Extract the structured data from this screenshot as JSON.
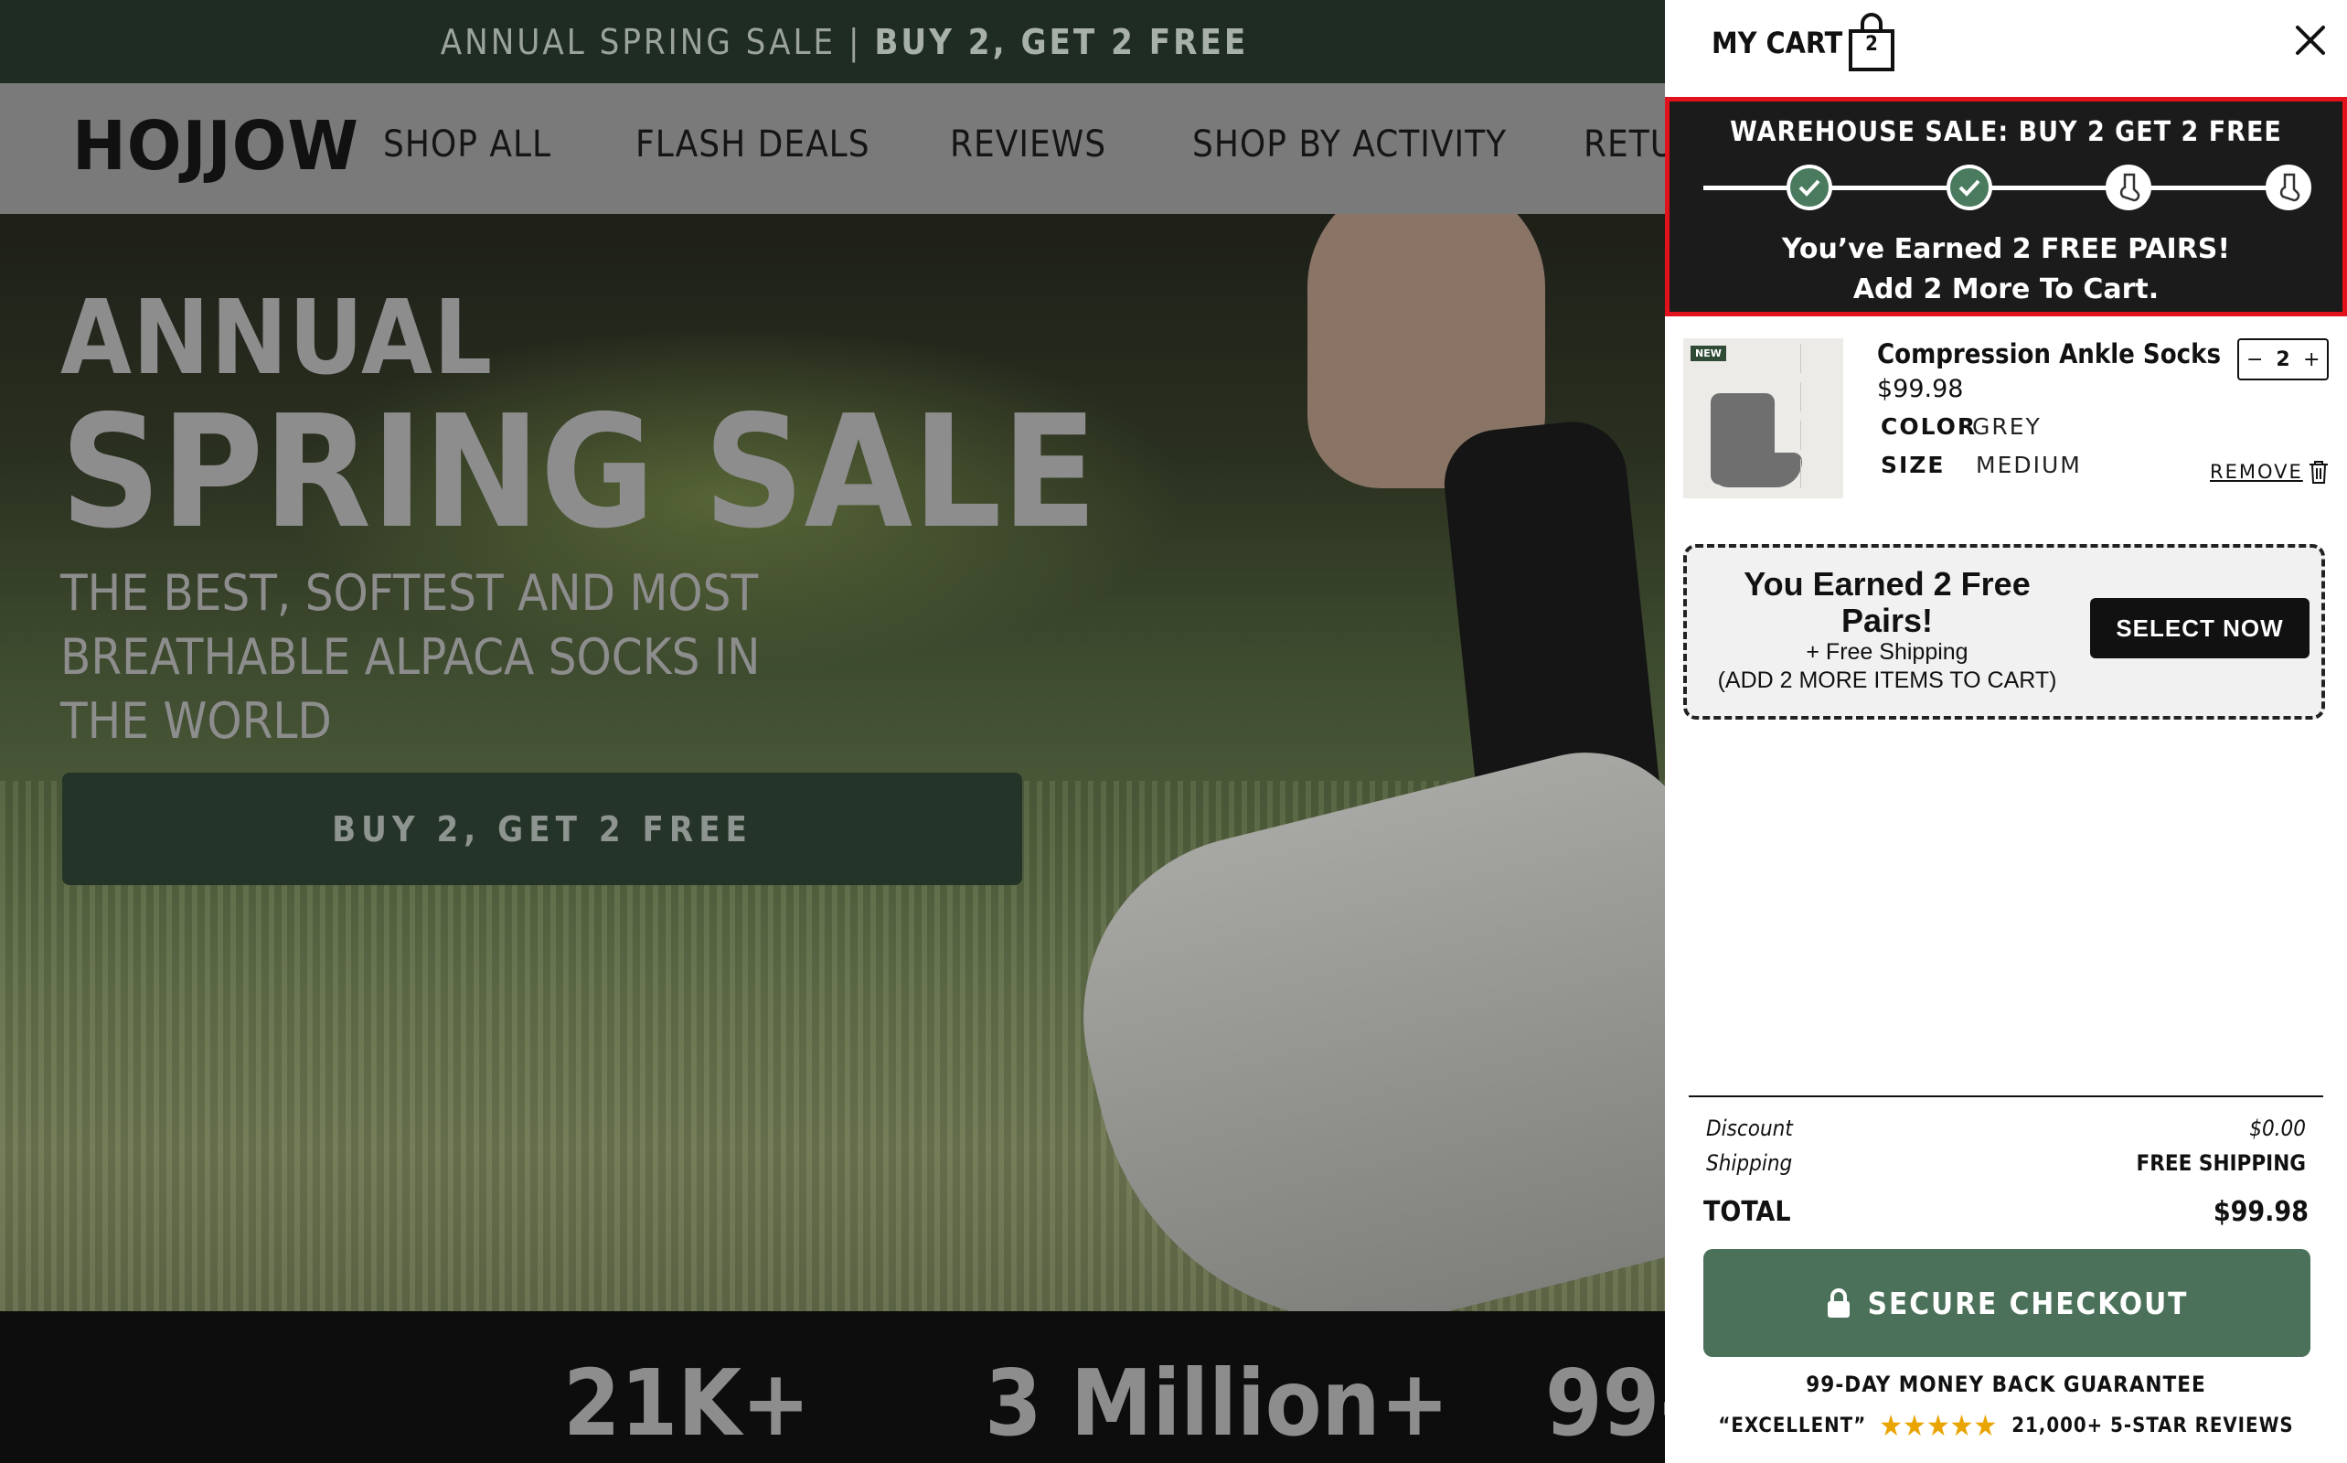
{
  "announcement": {
    "text_a": "ANNUAL SPRING SALE | ",
    "text_b": "BUY 2, GET 2 FREE"
  },
  "brand": {
    "logo": "HOJJOW"
  },
  "nav": {
    "items": [
      "SHOP ALL",
      "FLASH DEALS",
      "REVIEWS",
      "SHOP BY ACTIVITY",
      "RETU"
    ]
  },
  "hero": {
    "title_line1": "ANNUAL",
    "title_line2": "SPRING SALE",
    "subtitle": "THE BEST, SOFTEST AND MOST BREATHABLE ALPACA SOCKS IN THE WORLD",
    "cta": "BUY 2, GET 2 FREE"
  },
  "stats": {
    "values": [
      "21K+",
      "3 Million+",
      "99-"
    ]
  },
  "cart": {
    "title": "MY CART",
    "count": "2",
    "promo": {
      "title": "WAREHOUSE SALE: BUY 2 GET 2 FREE",
      "message_line1": "You’ve Earned 2 FREE PAIRS!",
      "message_line2": "Add 2 More To Cart.",
      "steps_completed": 2,
      "steps_total": 4
    },
    "item": {
      "badge": "NEW",
      "name": "Compression Ankle Socks",
      "price": "$99.98",
      "color_label": "COLOR",
      "color_value": "GREY",
      "size_label": "SIZE",
      "size_value": "MEDIUM",
      "quantity": "2",
      "minus": "−",
      "plus": "+",
      "remove_label": "REMOVE"
    },
    "offer": {
      "headline": "You Earned 2 Free Pairs!",
      "line1": "+ Free Shipping",
      "line2": "(ADD 2 MORE ITEMS TO CART)",
      "button": "SELECT NOW"
    },
    "summary": {
      "discount_label": "Discount",
      "discount_value": "$0.00",
      "shipping_label": "Shipping",
      "shipping_value": "FREE SHIPPING",
      "total_label": "TOTAL",
      "total_value": "$99.98"
    },
    "checkout_label": "SECURE CHECKOUT",
    "guarantee": "99-DAY MONEY BACK GUARANTEE",
    "rating_word": "“EXCELLENT”",
    "stars": "★★★★★",
    "reviews_count": "21,000+ 5-STAR REVIEWS"
  },
  "colors": {
    "brand_green": "#4b715a",
    "promo_bg": "#1b1b1b",
    "highlight_red": "#e3111b",
    "star": "#e9a400"
  },
  "icons": [
    "bag-icon",
    "close-icon",
    "check-icon",
    "sock-icon",
    "trash-icon",
    "lock-icon",
    "star-icon"
  ]
}
